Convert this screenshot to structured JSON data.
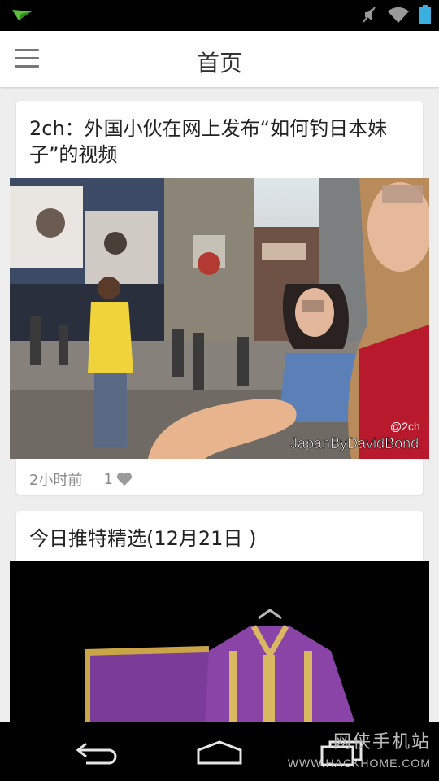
{
  "header": {
    "title": "首页"
  },
  "feed": {
    "cards": [
      {
        "title": "2ch：外国小伙在网上发布“如何钓日本妹子”的视频",
        "image_caption": "JapanByDavidBond",
        "image_watermark": "@2ch",
        "time": "2小时前",
        "likes": "1"
      },
      {
        "title": "今日推特精选(12月21日 )"
      }
    ]
  },
  "watermark": {
    "cn": "网侠手机站",
    "en": "WWW.HACKHOME.COM"
  },
  "colors": {
    "header_bg": "#ffffff",
    "feed_bg": "#eeeeee",
    "status_bar": "#000000",
    "accent_notification": "#4caf50",
    "battery": "#3bb0e0"
  }
}
